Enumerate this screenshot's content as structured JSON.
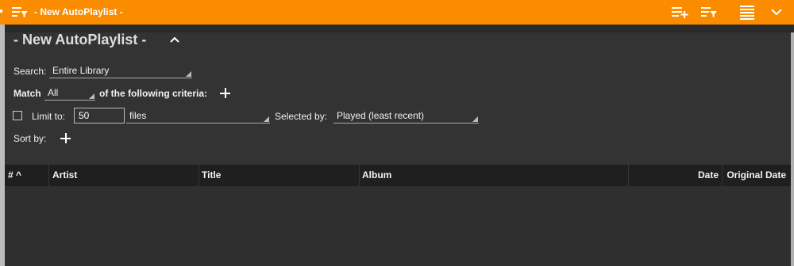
{
  "titlebar": {
    "title": "- New AutoPlaylist -",
    "icons": [
      "filter-list-icon",
      "add-to-list-icon",
      "filter-list-icon",
      "list-view-icon",
      "chevron-down-icon"
    ],
    "accent": "#fb8c00"
  },
  "panel": {
    "title": "- New AutoPlaylist -"
  },
  "criteria": {
    "search_label": "Search:",
    "search_value": "Entire Library",
    "match_label": "Match",
    "match_value": "All",
    "match_suffix": "of the following criteria:",
    "limit_label": "Limit to:",
    "limit_value": "50",
    "limit_unit": "files",
    "selected_by_label": "Selected by:",
    "selected_by_value": "Played (least recent)",
    "sort_label": "Sort by:"
  },
  "table": {
    "columns": [
      "# ^",
      "Artist",
      "Title",
      "Album",
      "Date",
      "Original Date"
    ]
  }
}
